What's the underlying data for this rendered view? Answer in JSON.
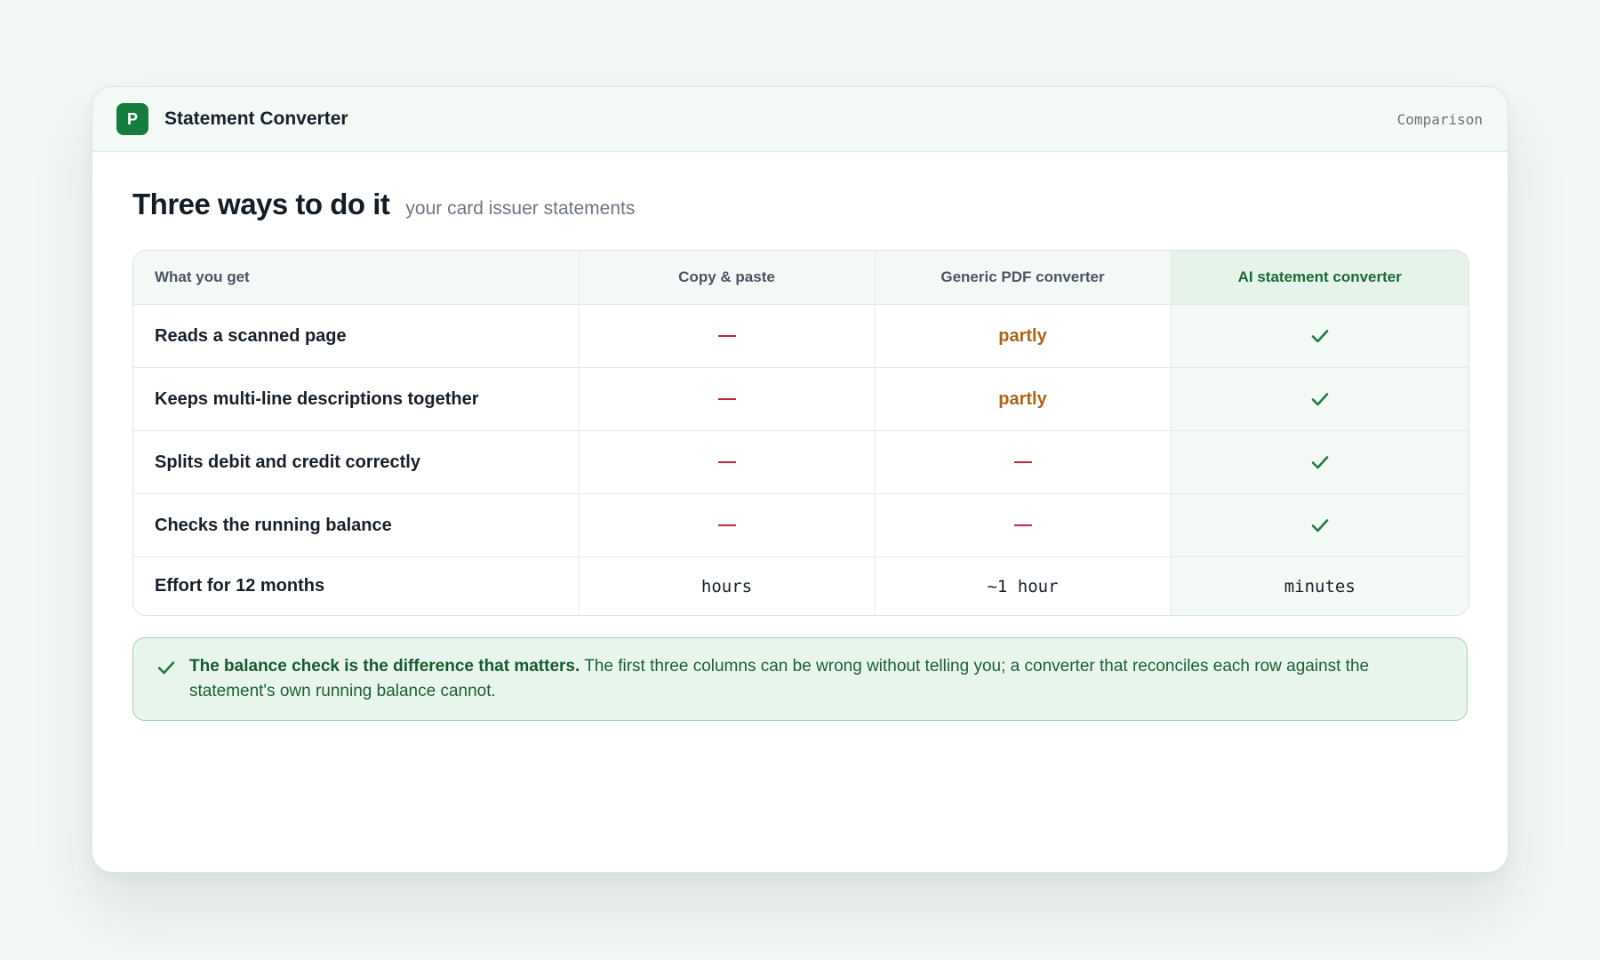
{
  "app": {
    "logo_letter": "P",
    "title": "Statement Converter",
    "section_label": "Comparison"
  },
  "page": {
    "heading": "Three ways to do it",
    "subheading": "your card issuer statements"
  },
  "table": {
    "headers": [
      "What you get",
      "Copy & paste",
      "Generic PDF converter",
      "AI statement converter"
    ],
    "rows": [
      {
        "feature": "Reads a scanned page",
        "cells": [
          {
            "kind": "no",
            "text": "—"
          },
          {
            "kind": "partial",
            "text": "partly"
          },
          {
            "kind": "yes",
            "text": "✓"
          }
        ]
      },
      {
        "feature": "Keeps multi-line descriptions together",
        "cells": [
          {
            "kind": "no",
            "text": "—"
          },
          {
            "kind": "partial",
            "text": "partly"
          },
          {
            "kind": "yes",
            "text": "✓"
          }
        ]
      },
      {
        "feature": "Splits debit and credit correctly",
        "cells": [
          {
            "kind": "no",
            "text": "—"
          },
          {
            "kind": "no",
            "text": "—"
          },
          {
            "kind": "yes",
            "text": "✓"
          }
        ]
      },
      {
        "feature": "Checks the running balance",
        "cells": [
          {
            "kind": "no",
            "text": "—"
          },
          {
            "kind": "no",
            "text": "—"
          },
          {
            "kind": "yes",
            "text": "✓"
          }
        ]
      },
      {
        "feature": "Effort for 12 months",
        "cells": [
          {
            "kind": "text",
            "text": "hours"
          },
          {
            "kind": "text",
            "text": "~1 hour"
          },
          {
            "kind": "text",
            "text": "minutes"
          }
        ]
      }
    ]
  },
  "callout": {
    "icon": "check-icon",
    "bold": "The balance check is the difference that matters.",
    "text": " The first three columns can be wrong without telling you; a converter that reconciles each row against the statement's own running balance cannot."
  },
  "colors": {
    "brand": "#177c3f",
    "no": "#c0283f",
    "partial": "#a9661a",
    "yes": "#1f7a43",
    "highlight_column": "#f3f9f5"
  }
}
